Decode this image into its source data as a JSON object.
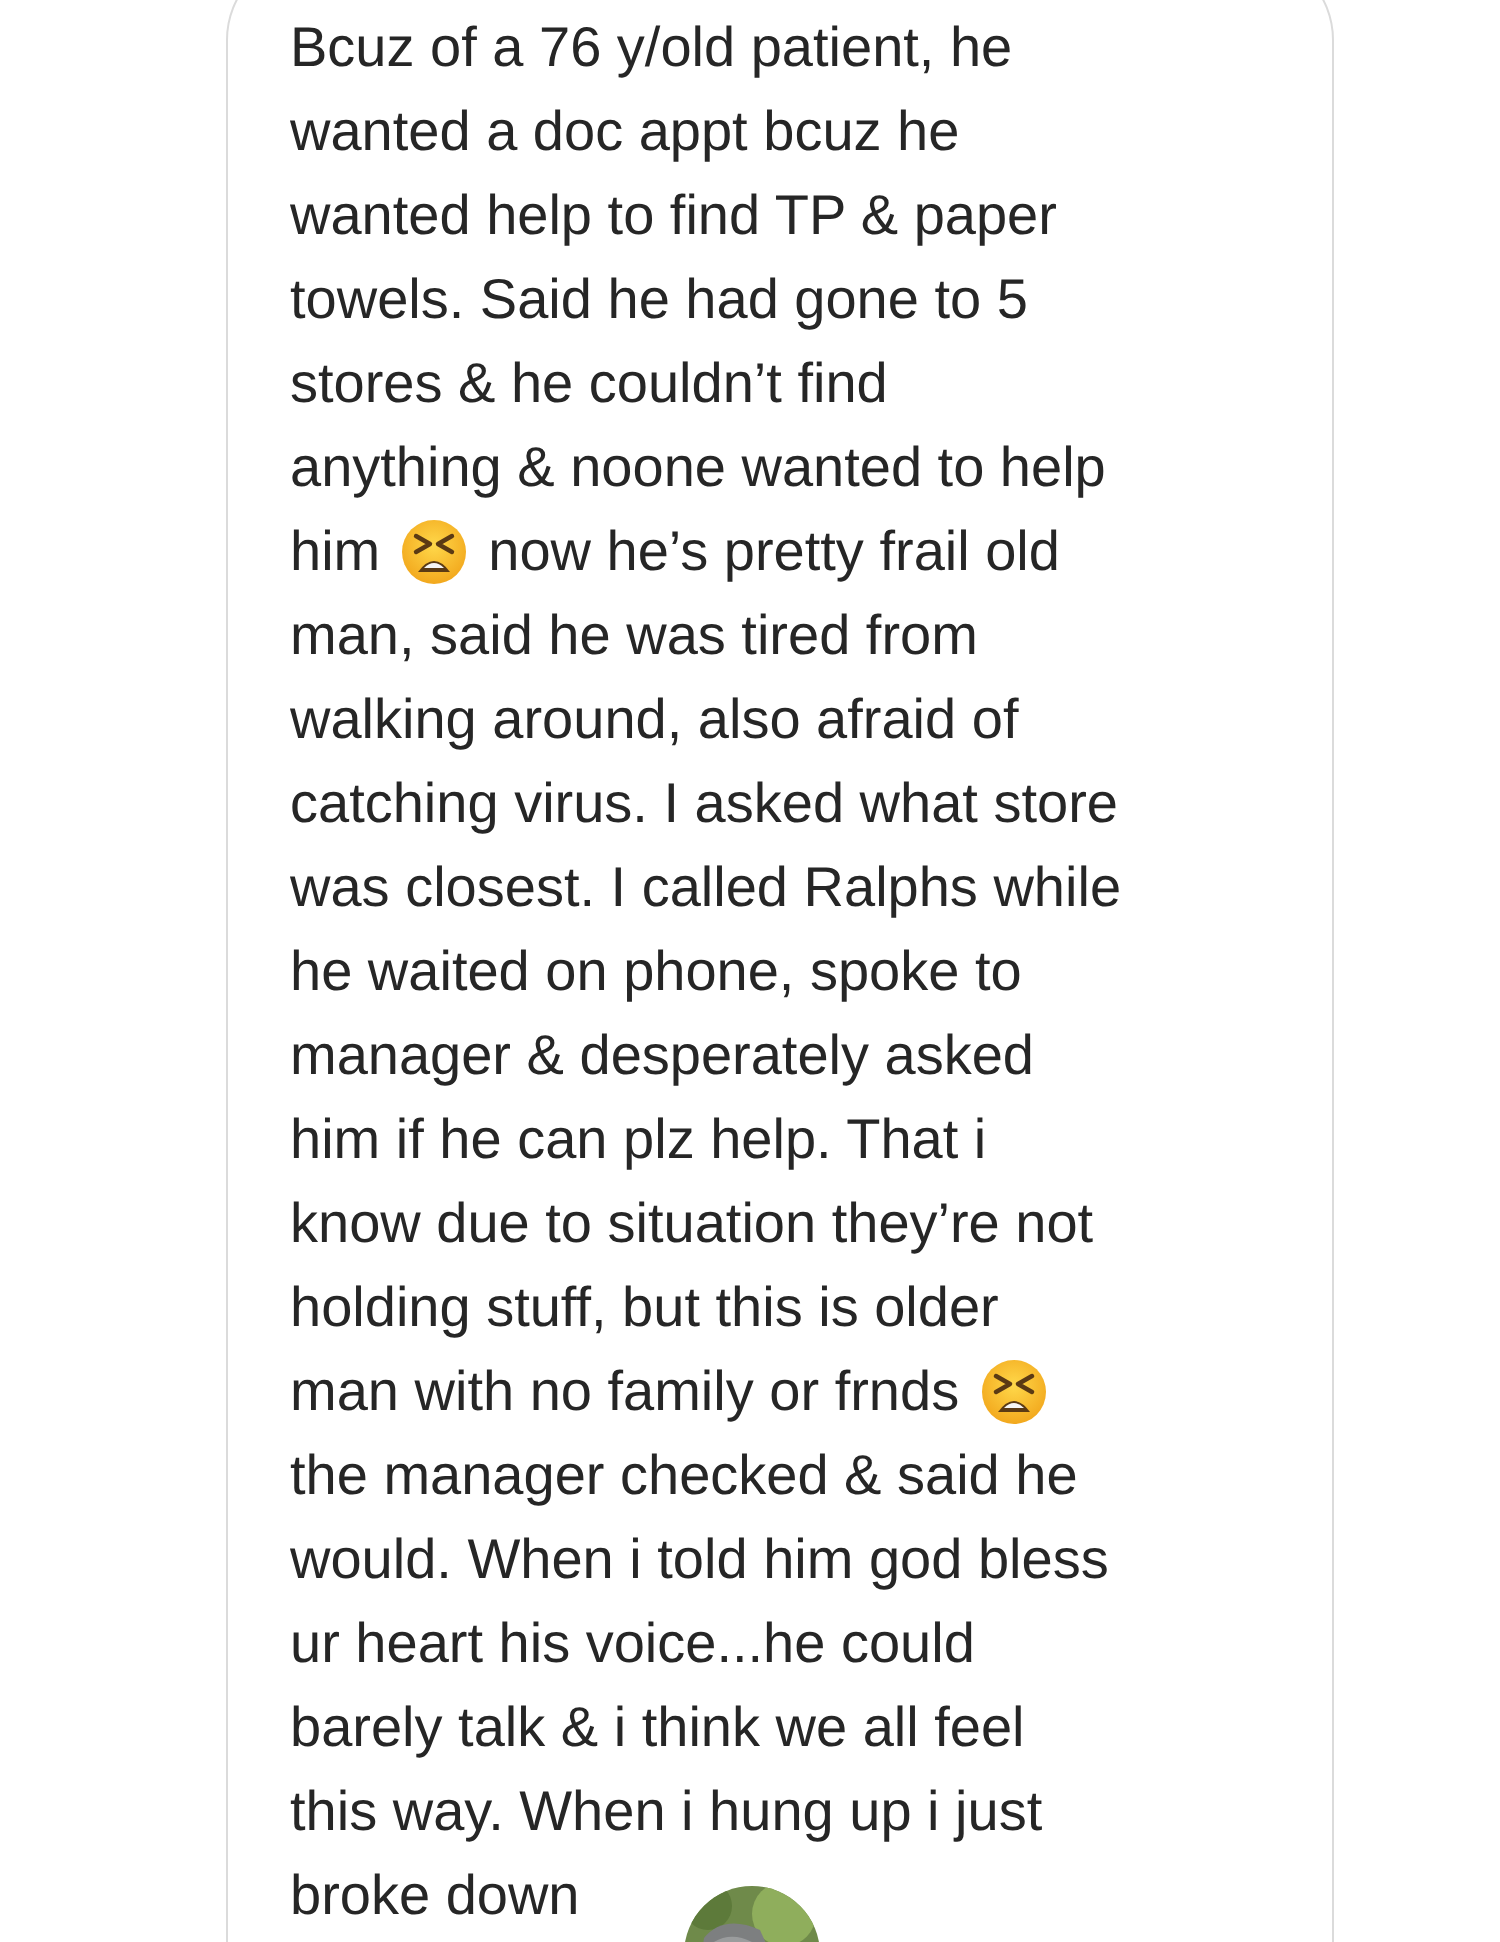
{
  "message": {
    "lines": [
      [
        {
          "kind": "text",
          "text": "Bcuz of a 76 y/old patient, he"
        }
      ],
      [
        {
          "kind": "text",
          "text": "wanted a doc appt bcuz he"
        }
      ],
      [
        {
          "kind": "text",
          "text": "wanted help to find TP & paper"
        }
      ],
      [
        {
          "kind": "text",
          "text": "towels. Said he had gone to 5"
        }
      ],
      [
        {
          "kind": "text",
          "text": "stores & he couldn’t find"
        }
      ],
      [
        {
          "kind": "text",
          "text": "anything & noone wanted to help"
        }
      ],
      [
        {
          "kind": "text",
          "text": "him"
        },
        {
          "kind": "emoji"
        },
        {
          "kind": "text",
          "text": "now he’s pretty frail old"
        }
      ],
      [
        {
          "kind": "text",
          "text": "man, said he was tired from"
        }
      ],
      [
        {
          "kind": "text",
          "text": "walking around, also afraid of"
        }
      ],
      [
        {
          "kind": "text",
          "text": "catching virus. I asked what store"
        }
      ],
      [
        {
          "kind": "text",
          "text": "was closest. I called Ralphs while"
        }
      ],
      [
        {
          "kind": "text",
          "text": "he waited on phone, spoke to"
        }
      ],
      [
        {
          "kind": "text",
          "text": "manager & desperately asked"
        }
      ],
      [
        {
          "kind": "text",
          "text": "him if he can plz help. That i"
        }
      ],
      [
        {
          "kind": "text",
          "text": "know due to situation they’re not"
        }
      ],
      [
        {
          "kind": "text",
          "text": "holding stuff, but this is older"
        }
      ],
      [
        {
          "kind": "text",
          "text": "man with no family or frnds"
        },
        {
          "kind": "emoji"
        }
      ],
      [
        {
          "kind": "text",
          "text": "the manager checked & said he"
        }
      ],
      [
        {
          "kind": "text",
          "text": "would. When i told him god bless"
        }
      ],
      [
        {
          "kind": "text",
          "text": "ur heart his voice...he could"
        }
      ],
      [
        {
          "kind": "text",
          "text": "barely talk & i think we all feel"
        }
      ],
      [
        {
          "kind": "text",
          "text": "this way. When i hung up i just"
        }
      ],
      [
        {
          "kind": "text",
          "text": "broke down"
        }
      ]
    ]
  }
}
